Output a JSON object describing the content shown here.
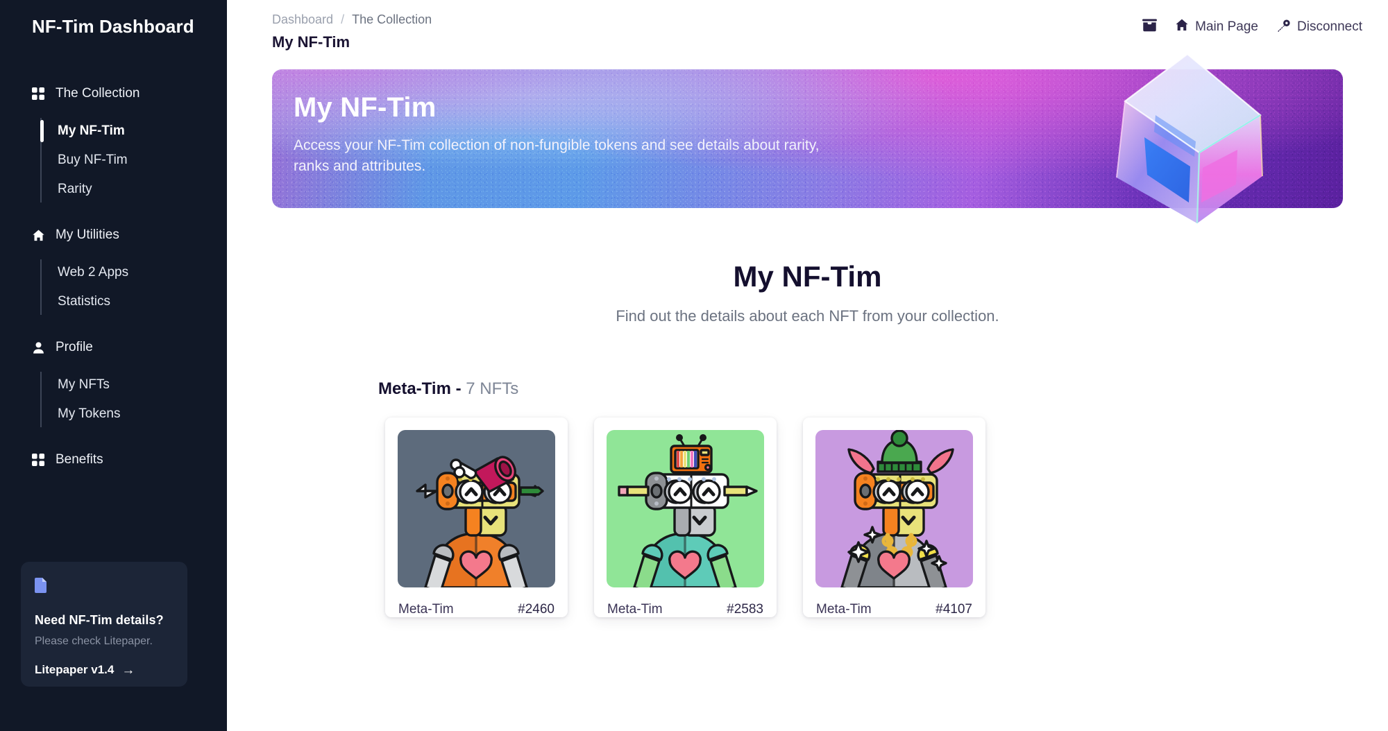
{
  "sidebar": {
    "brand": "NF-Tim Dashboard",
    "groups": [
      {
        "label": "The Collection",
        "icon": "grid-icon",
        "items": [
          {
            "label": "My NF-Tim",
            "active": true
          },
          {
            "label": "Buy NF-Tim",
            "active": false
          },
          {
            "label": "Rarity",
            "active": false
          }
        ]
      },
      {
        "label": "My Utilities",
        "icon": "home-icon",
        "items": [
          {
            "label": "Web 2 Apps",
            "active": false
          },
          {
            "label": "Statistics",
            "active": false
          }
        ]
      },
      {
        "label": "Profile",
        "icon": "user-icon",
        "items": [
          {
            "label": "My NFTs",
            "active": false
          },
          {
            "label": "My Tokens",
            "active": false
          }
        ]
      },
      {
        "label": "Benefits",
        "icon": "grid-icon",
        "items": []
      }
    ],
    "litepaper_card": {
      "icon": "document-icon",
      "title": "Need NF-Tim details?",
      "subtitle": "Please check Litepaper.",
      "link_label": "Litepaper v1.4",
      "link_arrow": "→"
    }
  },
  "header": {
    "breadcrumb": {
      "parent": "Dashboard",
      "separator": "/",
      "current": "The Collection"
    },
    "page_title": "My NF-Tim",
    "nav": [
      {
        "label": "",
        "icon": "archive-icon"
      },
      {
        "label": "Main Page",
        "icon": "home-icon"
      },
      {
        "label": "Disconnect",
        "icon": "key-icon"
      }
    ]
  },
  "hero": {
    "title": "My NF-Tim",
    "description": "Access your NF-Tim collection of non-fungible tokens and see details about rarity, ranks and attributes.",
    "artwork": "iridescent-glass-cube"
  },
  "main": {
    "title": "My NF-Tim",
    "subtitle": "Find out the details about each NFT from your collection.",
    "group": {
      "name": "Meta-Tim -",
      "count": "7 NFTs"
    },
    "cards": [
      {
        "name": "Meta-Tim",
        "id": "#2460",
        "bg": "#5d6b7c",
        "body": "#f07f2a",
        "head": "#f58220",
        "panel": "#e8e27a",
        "accent": "#c2185b",
        "arm": "#b9bcc0",
        "hat": "megaphone-bone"
      },
      {
        "name": "Meta-Tim",
        "id": "#2583",
        "bg": "#90e597",
        "body": "#55c7b5",
        "head": "#ffffff",
        "panel": "#d8dadd",
        "accent": "#ff7043",
        "arm": "#8fdc8f",
        "hat": "retro-tv"
      },
      {
        "name": "Meta-Tim",
        "id": "#4107",
        "bg": "#c89ae0",
        "body": "#b0b4b8",
        "head": "#f58220",
        "panel": "#e8e27a",
        "accent": "#f2748c",
        "arm": "#6d7278",
        "hat": "green-beanie"
      }
    ]
  },
  "colors": {
    "sidebar_bg": "#111827",
    "sidebar_card_bg": "#1c2537",
    "accent_blue": "#7b93f0",
    "text_dark": "#1b1433",
    "text_muted": "#6b7280",
    "hero_gradient_start": "#9a6fd6",
    "hero_gradient_mid": "#5d9ae8",
    "hero_gradient_end": "#5a219e"
  }
}
